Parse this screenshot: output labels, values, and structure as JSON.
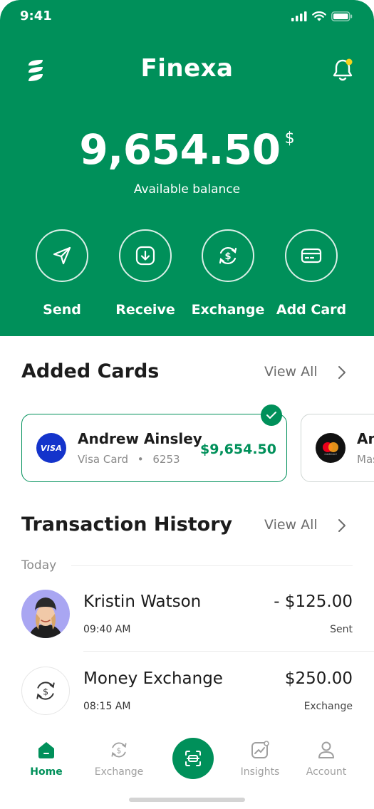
{
  "status_bar": {
    "time": "9:41"
  },
  "header": {
    "title": "Finexa",
    "balance": "9,654.50",
    "currency": "$",
    "balance_label": "Available balance",
    "brand_color": "#00905A",
    "notification_dot_color": "#F4D21F"
  },
  "actions": [
    {
      "label": "Send",
      "icon": "send-icon"
    },
    {
      "label": "Receive",
      "icon": "receive-icon"
    },
    {
      "label": "Exchange",
      "icon": "exchange-icon"
    },
    {
      "label": "Add Card",
      "icon": "card-icon"
    }
  ],
  "cards_section": {
    "title": "Added Cards",
    "view_all": "View All",
    "cards": [
      {
        "brand": "VISA",
        "holder": "Andrew Ainsley",
        "type": "Visa Card",
        "dot": "•",
        "last4": "6253",
        "balance": "$9,654.50",
        "selected": true
      },
      {
        "brand": "mastercard",
        "holder": "An",
        "type": "Mas",
        "selected": false
      }
    ]
  },
  "transactions_section": {
    "title": "Transaction History",
    "view_all": "View All",
    "date_label": "Today",
    "items": [
      {
        "name": "Kristin Watson",
        "time": "09:40 AM",
        "amount": "- $125.00",
        "type": "Sent"
      },
      {
        "name": "Money Exchange",
        "time": "08:15 AM",
        "amount": "$250.00",
        "type": "Exchange"
      }
    ]
  },
  "bottom_nav": {
    "items": [
      {
        "label": "Home",
        "active": true
      },
      {
        "label": "Exchange",
        "active": false
      },
      {
        "label": "Insights",
        "active": false
      },
      {
        "label": "Account",
        "active": false
      }
    ]
  }
}
